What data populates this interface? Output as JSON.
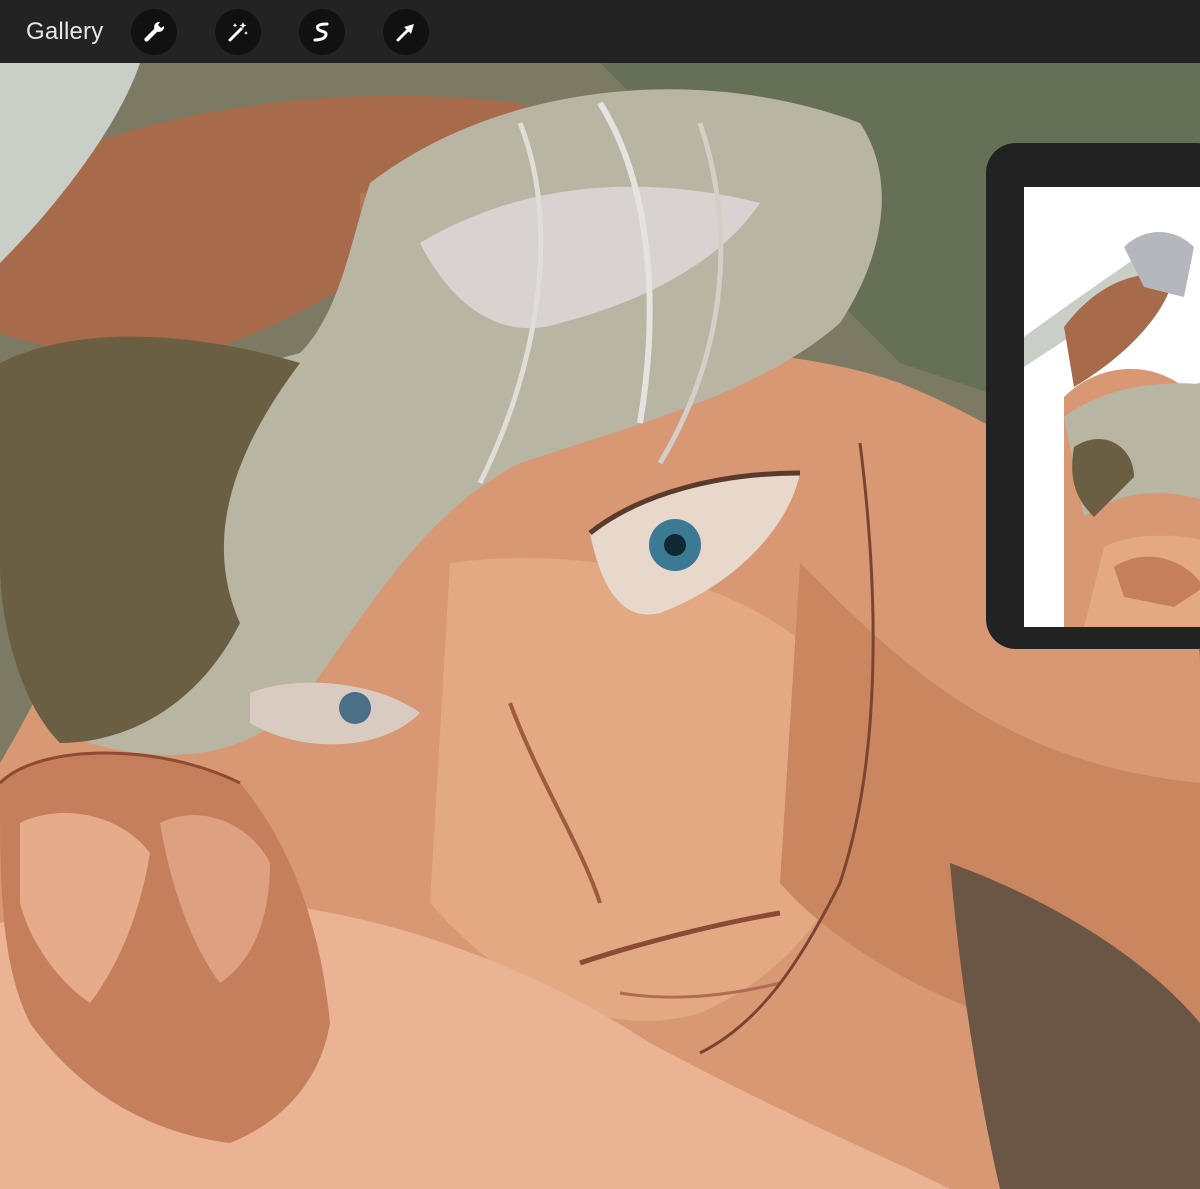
{
  "toolbar": {
    "gallery_label": "Gallery",
    "tools": [
      {
        "name": "actions",
        "icon": "wrench-icon"
      },
      {
        "name": "adjustments",
        "icon": "magic-wand-icon"
      },
      {
        "name": "selection",
        "icon": "selection-s-icon"
      },
      {
        "name": "transform",
        "icon": "arrow-cursor-icon"
      }
    ]
  },
  "reference": {
    "icon": "reference-thumbnail"
  },
  "colors": {
    "toolbar_bg": "#232323",
    "tool_button_bg": "#111111",
    "icon_color": "#ffffff",
    "panel_bg": "#222222"
  }
}
